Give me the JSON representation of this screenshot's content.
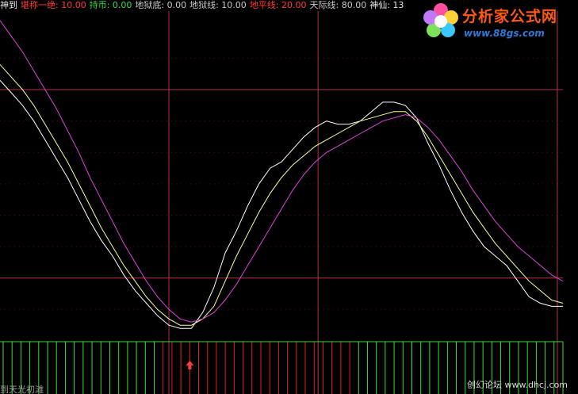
{
  "header": {
    "items": [
      {
        "text": "神到",
        "color": "#e6e6e6"
      },
      {
        "text": "堪称一绝: 10.00",
        "color": "#ff3b3b"
      },
      {
        "text": "持币: 0.00",
        "color": "#3cdc3c"
      },
      {
        "text": "地狱底: 0.00",
        "color": "#c8c8c8"
      },
      {
        "text": "地狱线: 10.00",
        "color": "#c8c8c8"
      },
      {
        "text": "地平线: 20.00",
        "color": "#ff3b3b"
      },
      {
        "text": "天际线: 80.00",
        "color": "#c8c8c8"
      },
      {
        "text": "神仙: 13",
        "color": "#e6e6e6"
      }
    ]
  },
  "logo": {
    "name": "分析家公式网",
    "url": "www.88gs.com"
  },
  "watermark": "创幻论坛 www.dhcj.com",
  "footer_text": "到天光初滩",
  "chart_data": {
    "type": "line",
    "x_range": [
      0,
      100
    ],
    "y_range": [
      0,
      105
    ],
    "horizontal_lines": [
      20,
      80
    ],
    "vertical_markers": [
      30,
      56.5,
      99
    ],
    "series": [
      {
        "color": "#ffffff",
        "x": [
          0,
          2,
          4,
          6,
          8,
          10,
          12,
          14,
          16,
          18,
          20,
          22,
          24,
          26,
          28,
          30,
          32,
          34,
          36,
          38,
          40,
          42,
          44,
          46,
          48,
          50,
          52,
          54,
          56,
          58,
          60,
          62,
          64,
          66,
          68,
          70,
          72,
          74,
          76,
          78,
          80,
          82,
          84,
          86,
          88,
          90,
          92,
          94,
          96,
          98,
          100
        ],
        "values": [
          83,
          79,
          75,
          70,
          64,
          58,
          52,
          45,
          38,
          32,
          27,
          21,
          16,
          12,
          8,
          5,
          4,
          4,
          9,
          17,
          28,
          35,
          43,
          50,
          55,
          57,
          61,
          65,
          68,
          70,
          69,
          69,
          70,
          73,
          76,
          76,
          75,
          71,
          63,
          56,
          48,
          41,
          35,
          30,
          27,
          24,
          19,
          14,
          12,
          11,
          11
        ]
      },
      {
        "color": "#ffff99",
        "x": [
          0,
          2,
          4,
          6,
          8,
          10,
          12,
          14,
          16,
          18,
          20,
          22,
          24,
          26,
          28,
          30,
          32,
          34,
          36,
          38,
          40,
          42,
          44,
          46,
          48,
          50,
          52,
          54,
          56,
          58,
          60,
          62,
          64,
          66,
          68,
          70,
          72,
          74,
          76,
          78,
          80,
          82,
          84,
          86,
          88,
          90,
          92,
          94,
          96,
          98,
          100
        ],
        "values": [
          88,
          84,
          80,
          75,
          69,
          63,
          57,
          50,
          43,
          36,
          30,
          24,
          19,
          14,
          10,
          7,
          5,
          5,
          7,
          11,
          19,
          27,
          34,
          41,
          47,
          52,
          56,
          59,
          62,
          64,
          66,
          68,
          70,
          71,
          72,
          73,
          73,
          70,
          65,
          59,
          53,
          47,
          41,
          36,
          31,
          27,
          23,
          19,
          16,
          13,
          12
        ]
      },
      {
        "color": "#dd44dd",
        "x": [
          0,
          2,
          4,
          6,
          8,
          10,
          12,
          14,
          16,
          18,
          20,
          22,
          24,
          26,
          28,
          30,
          32,
          34,
          36,
          38,
          40,
          42,
          44,
          46,
          48,
          50,
          52,
          54,
          56,
          58,
          60,
          62,
          64,
          66,
          68,
          70,
          72,
          74,
          76,
          78,
          80,
          82,
          84,
          86,
          88,
          90,
          92,
          94,
          96,
          98,
          100
        ],
        "values": [
          102,
          97,
          92,
          86,
          80,
          74,
          67,
          60,
          52,
          45,
          38,
          31,
          25,
          19,
          14,
          10,
          7,
          6,
          7,
          9,
          13,
          18,
          24,
          30,
          36,
          42,
          48,
          53,
          57,
          60,
          62,
          64,
          66,
          68,
          70,
          71,
          72,
          71,
          68,
          64,
          59,
          54,
          48,
          43,
          38,
          34,
          30,
          27,
          24,
          21,
          19
        ]
      }
    ],
    "bars": {
      "type": "bar",
      "count": 64,
      "signal": [
        "g",
        "g",
        "g",
        "g",
        "g",
        "g",
        "g",
        "g",
        "g",
        "g",
        "g",
        "g",
        "g",
        "g",
        "g",
        "g",
        "g",
        "g",
        "r",
        "r",
        "r",
        "r",
        "r",
        "r",
        "r",
        "r",
        "r",
        "r",
        "r",
        "r",
        "r",
        "r",
        "r",
        "r",
        "r",
        "r",
        "r",
        "r",
        "r",
        "r",
        "g",
        "g",
        "g",
        "g",
        "g",
        "g",
        "g",
        "g",
        "g",
        "g",
        "g",
        "g",
        "g",
        "g",
        "g",
        "g",
        "g",
        "g",
        "g",
        "g",
        "g",
        "g",
        "g",
        "g"
      ],
      "colors": {
        "g": "#3cdc3c",
        "r": "#e02020"
      },
      "buy_marker_index": 21,
      "buy_marker_color": "#ff3b3b"
    }
  }
}
